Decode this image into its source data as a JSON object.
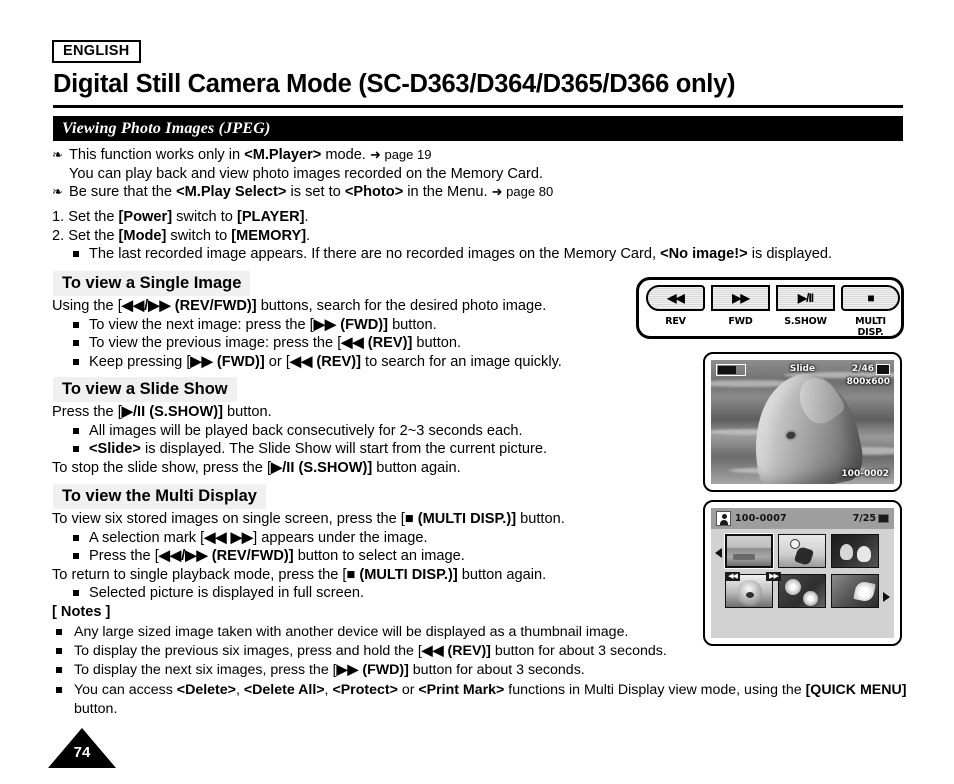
{
  "header": {
    "language_badge": "ENGLISH",
    "title": "Digital Still Camera Mode (SC-D363/D364/D365/D366 only)",
    "section_bar": "Viewing Photo Images (JPEG)"
  },
  "intro": {
    "bullet1_a": "This function works only in ",
    "bullet1_mode": "<M.Player>",
    "bullet1_b": " mode. ",
    "bullet1_pageref": "➜ page 19",
    "bullet1_line2": "You can play back and view photo images recorded on the Memory Card.",
    "bullet2_a": "Be sure that the ",
    "bullet2_menu": "<M.Play Select>",
    "bullet2_b": " is set to ",
    "bullet2_value": "<Photo>",
    "bullet2_c": " in the Menu. ",
    "bullet2_pageref": "➜ page 80"
  },
  "steps": [
    {
      "num": "1. ",
      "a": "Set the ",
      "k1": "[Power]",
      "b": " switch to ",
      "k2": "[PLAYER]",
      "c": "."
    },
    {
      "num": "2. ",
      "a": "Set the ",
      "k1": "[Mode]",
      "b": " switch to ",
      "k2": "[MEMORY]",
      "c": "."
    }
  ],
  "step2_note": {
    "a": "The last recorded image appears. If there are no recorded images on the Memory Card, ",
    "b": "<No image!>",
    "c": " is displayed."
  },
  "sections": {
    "single": {
      "heading": "To view a Single Image",
      "lead_a": "Using the [",
      "lead_btn": "◀◀/▶▶ (REV/FWD)]",
      "lead_b": " buttons, search for the desired photo image.",
      "bullets": [
        {
          "a": "To view the next image: press the [",
          "k": "▶▶ (FWD)]",
          "b": " button."
        },
        {
          "a": "To view the previous image: press the [",
          "k": "◀◀ (REV)]",
          "b": " button."
        },
        {
          "a": "Keep pressing [",
          "k": "▶▶ (FWD)]",
          "b": " or [",
          "k2": "◀◀ (REV)]",
          "c": " to search for an image quickly."
        }
      ]
    },
    "slideshow": {
      "heading": "To view a Slide Show",
      "lead_a": "Press the [",
      "lead_btn": "▶/II (S.SHOW)]",
      "lead_b": " button.",
      "bullets": [
        {
          "a": "All images will be played back consecutively for 2~3 seconds each."
        },
        {
          "a": "",
          "k": "<Slide>",
          "b": " is displayed. The Slide Show will start from the current picture."
        }
      ],
      "tail_a": "To stop the slide show, press the [",
      "tail_btn": "▶/II (S.SHOW)]",
      "tail_b": " button again."
    },
    "multi": {
      "heading": "To view the Multi Display",
      "lead_a": "To view six stored images on single screen, press the [",
      "lead_btn": "■ (MULTI DISP.)]",
      "lead_b": " button.",
      "bullets": [
        {
          "a": "A selection mark [",
          "k": "◀◀ ▶▶",
          "b": "] appears under the image."
        },
        {
          "a": "Press the [",
          "k": "◀◀/▶▶ (REV/FWD)]",
          "b": " button to select an image."
        }
      ],
      "tail_a": "To return to single playback mode, press the [",
      "tail_btn": "■ (MULTI DISP.)]",
      "tail_b": " button again.",
      "tail_bullet": "Selected picture is displayed in full screen."
    }
  },
  "notes": {
    "title": "[ Notes ]",
    "items": [
      {
        "a": "Any large sized image taken with another device will be displayed as a thumbnail image."
      },
      {
        "a": "To display the previous six images, press and hold the [",
        "k": "◀◀ (REV)]",
        "b": " button for about 3 seconds."
      },
      {
        "a": "To display the next six images, press the [",
        "k": "▶▶ (FWD)]",
        "b": " button for about 3 seconds."
      },
      {
        "a": "You can access ",
        "k": "<Delete>",
        "b": ", ",
        "k2": "<Delete All>",
        "c": ", ",
        "k3": "<Protect>",
        "d": " or ",
        "k4": "<Print Mark>",
        "e": " functions in Multi Display view mode, using the ",
        "k5": "[QUICK MENU]",
        "f": " button."
      }
    ]
  },
  "page_number": "74",
  "illustrations": {
    "button_panel": {
      "buttons": [
        {
          "glyph": "◀◀",
          "label": "REV"
        },
        {
          "glyph": "▶▶",
          "label": "FWD"
        },
        {
          "glyph": "▶/II",
          "label": "S.SHOW"
        },
        {
          "glyph": "■",
          "label": "MULTI DISP."
        }
      ]
    },
    "lcd_single": {
      "mode_text": "Slide",
      "counter": "2/46",
      "resolution": "800x600",
      "file_number": "100-0002",
      "subject": "dolphin"
    },
    "lcd_multi": {
      "file_number": "100-0007",
      "counter": "7/25",
      "marks": [
        "◀◀",
        "▶▶"
      ],
      "thumbnails": [
        {
          "name": "landscape",
          "selected": true
        },
        {
          "name": "sports",
          "selected": false
        },
        {
          "name": "family",
          "selected": false
        },
        {
          "name": "dog",
          "selected": false
        },
        {
          "name": "flowers",
          "selected": false
        },
        {
          "name": "lotus",
          "selected": false
        }
      ]
    }
  }
}
